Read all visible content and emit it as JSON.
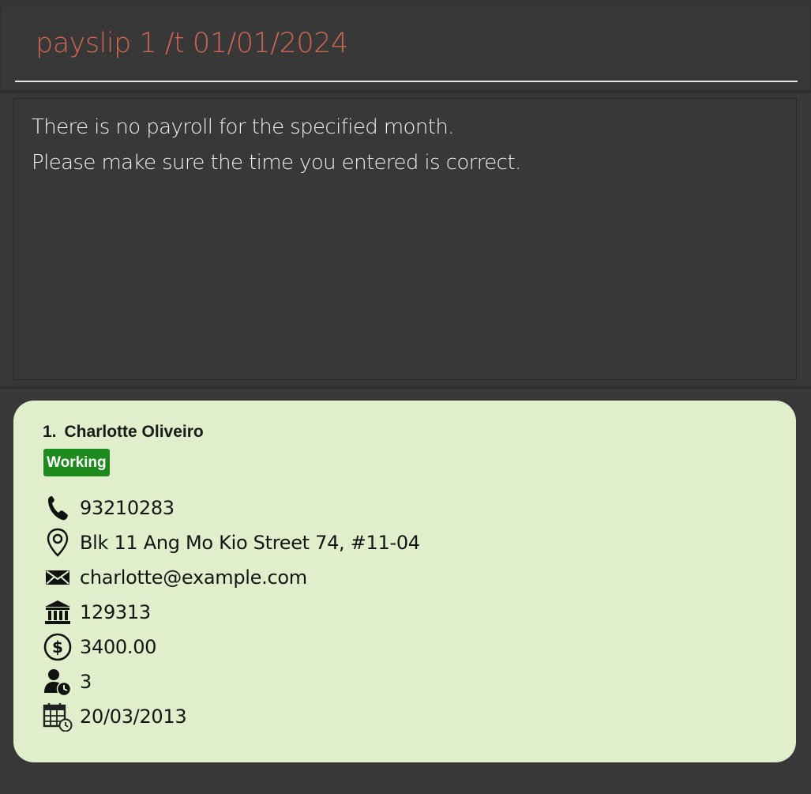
{
  "command_box": {
    "value": "payslip 1 /t 01/01/2024"
  },
  "result_display": {
    "lines": [
      "There is no payroll for the specified month.",
      "Please make sure the time you entered is correct."
    ]
  },
  "person_list": {
    "items": [
      {
        "index": "1.",
        "name": "Charlotte Oliveiro",
        "status": "Working",
        "status_color": "#1e8a1e",
        "phone": "93210283",
        "address": "Blk 11 Ang Mo Kio Street 74, #11-04",
        "email": "charlotte@example.com",
        "bank_account": "129313",
        "salary": "3400.00",
        "leave_days": "3",
        "start_date": "20/03/2013",
        "icons": {
          "phone": "phone-icon",
          "address": "location-pin-icon",
          "email": "envelope-icon",
          "bank_account": "bank-icon",
          "salary": "dollar-circle-icon",
          "leave_days": "person-clock-icon",
          "start_date": "calendar-clock-icon"
        }
      }
    ]
  },
  "colors": {
    "background": "#383838",
    "command_text": "#d06651",
    "card_background": "#e1eecb"
  }
}
